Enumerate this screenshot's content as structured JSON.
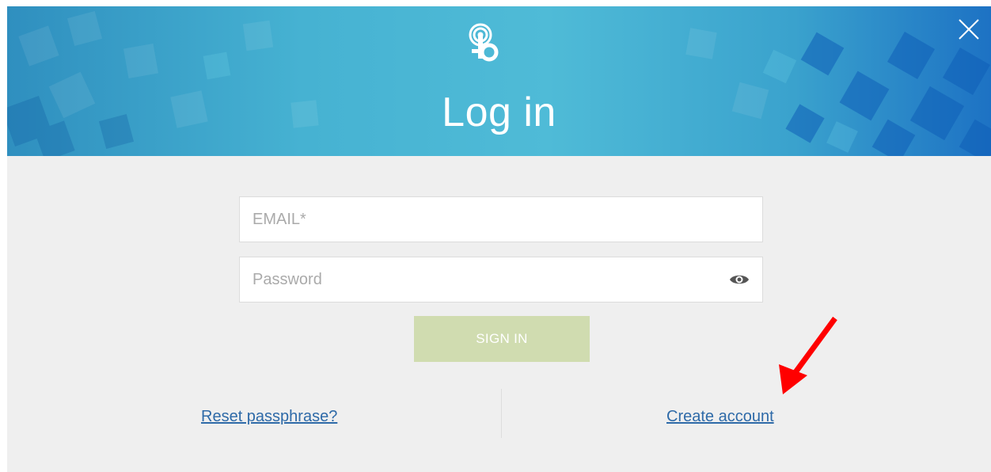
{
  "dialog": {
    "title": "Log in",
    "close_icon": "close-icon",
    "logo_icon": "broadcast-b-logo"
  },
  "form": {
    "email_placeholder": "EMAIL*",
    "email_value": "",
    "password_placeholder": "Password",
    "password_value": "",
    "show_password_icon": "eye-icon",
    "sign_in_label": "SIGN IN"
  },
  "links": {
    "reset": "Reset passphrase?",
    "create": "Create account"
  },
  "colors": {
    "header_accent": "#4fbbd7",
    "button_disabled": "#d0dcb0",
    "link": "#2e6aa8",
    "annotation_arrow": "#ff0000"
  }
}
